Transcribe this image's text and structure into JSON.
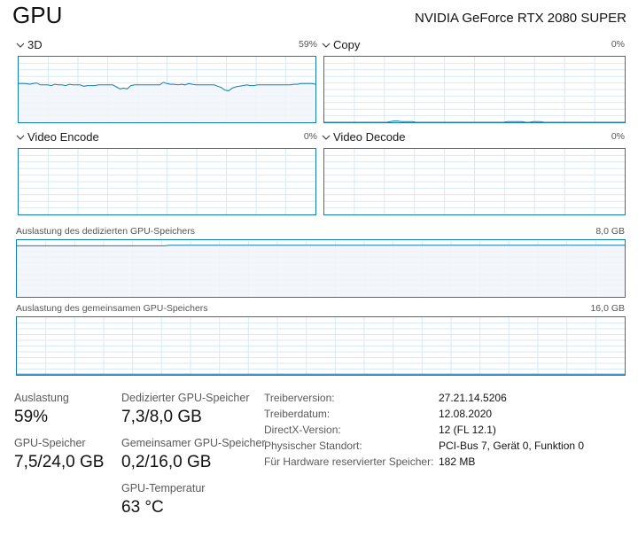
{
  "header": {
    "title": "GPU",
    "device_name": "NVIDIA GeForce RTX 2080 SUPER"
  },
  "engines": [
    {
      "label": "3D",
      "percent": "59%",
      "history_percent": [
        59,
        59,
        59,
        58,
        59,
        60,
        57,
        57,
        57,
        56,
        58,
        57,
        57,
        56,
        58,
        57,
        57,
        57,
        55,
        56,
        56,
        56,
        57,
        57,
        57,
        57,
        57,
        54,
        51,
        52,
        51,
        56,
        57,
        57,
        57,
        57,
        57,
        57,
        57,
        57,
        61,
        59,
        58,
        58,
        57,
        58,
        57,
        59,
        58,
        57,
        57,
        57,
        57,
        57,
        57,
        55,
        53,
        49,
        48,
        52,
        54,
        55,
        56,
        57,
        56,
        56,
        57,
        57,
        57,
        57,
        57,
        57,
        57,
        57,
        57,
        57,
        58,
        58,
        59,
        59,
        59,
        59,
        58
      ]
    },
    {
      "label": "Copy",
      "percent": "0%",
      "history_percent": [
        0,
        0,
        0,
        0,
        0,
        0,
        0,
        0,
        0,
        0,
        0,
        0,
        0,
        0,
        0,
        0,
        0,
        0,
        1,
        2,
        2,
        1,
        1,
        1,
        1,
        0,
        0,
        0,
        0,
        0,
        0,
        0,
        0,
        0,
        0,
        0,
        0,
        0,
        0,
        0,
        0,
        0,
        0,
        0,
        0,
        0,
        0,
        0,
        0,
        0,
        1,
        1,
        1,
        1,
        1,
        0,
        0,
        1,
        1,
        1,
        0,
        0,
        0,
        0,
        0,
        0,
        0,
        0,
        0,
        0,
        0,
        0,
        0,
        0,
        0,
        0,
        0,
        0,
        0,
        0,
        0,
        0,
        0
      ]
    },
    {
      "label": "Video Encode",
      "percent": "0%",
      "history_percent": []
    },
    {
      "label": "Video Decode",
      "percent": "0%",
      "history_percent": []
    }
  ],
  "memory_graphs": [
    {
      "label": "Auslastung des dedizierten GPU-Speichers",
      "max": "8,0 GB",
      "history_percent": [
        90,
        90,
        90,
        90,
        90,
        90,
        90,
        90,
        90,
        90,
        90,
        90,
        90,
        90,
        90,
        90,
        90,
        90,
        90,
        90,
        90,
        90,
        90,
        90,
        90,
        90,
        90,
        90,
        90,
        90,
        90,
        90,
        90,
        90,
        90,
        90,
        90,
        90,
        90,
        90,
        90,
        90,
        91,
        91,
        91,
        91,
        91,
        91,
        91,
        91,
        91,
        91,
        91,
        91,
        91,
        91,
        91,
        91,
        91,
        91,
        91,
        91,
        91,
        91,
        91,
        91,
        91,
        91,
        91,
        91,
        91,
        91,
        91,
        91,
        91,
        91,
        91,
        91,
        91,
        91,
        91,
        91,
        91,
        91,
        91,
        91,
        91,
        91,
        91,
        91,
        91,
        91,
        91,
        91,
        91,
        91,
        91,
        91,
        91,
        91,
        91,
        91,
        91,
        91,
        91,
        91,
        91,
        91,
        91,
        91,
        91,
        91,
        91,
        91,
        91,
        91,
        91,
        91,
        91,
        91,
        91,
        91,
        91,
        91,
        91,
        91,
        91,
        91,
        91,
        91,
        91,
        91,
        91,
        91,
        91,
        91,
        91,
        91,
        91,
        91,
        91,
        91,
        91,
        91,
        91,
        91,
        91,
        91,
        91,
        91,
        91,
        91,
        91,
        91,
        91,
        91,
        91,
        91,
        91,
        91,
        91,
        91,
        91,
        91,
        91,
        91,
        91,
        91,
        91
      ]
    },
    {
      "label": "Auslastung des gemeinsamen GPU-Speichers",
      "max": "16,0 GB",
      "history_percent": [
        1,
        1,
        1,
        1,
        1,
        1,
        1,
        1,
        1,
        1,
        1,
        1,
        1,
        1,
        1,
        1,
        1,
        1,
        1,
        1,
        1,
        1,
        1,
        1,
        1,
        1,
        1,
        1,
        1,
        1,
        1,
        1,
        1,
        1,
        1,
        1,
        1,
        1,
        1,
        1,
        1,
        1,
        1,
        1,
        1,
        1,
        1,
        1,
        1,
        1,
        1,
        1,
        1,
        1,
        1,
        1,
        1,
        1,
        1,
        1,
        1,
        1,
        1,
        1,
        1,
        1,
        1,
        1,
        1,
        1,
        1,
        1,
        1,
        1,
        1,
        1,
        1,
        1,
        1,
        1,
        1,
        1,
        1,
        1,
        1,
        1,
        1,
        1,
        1,
        1,
        1,
        1,
        1,
        1,
        1,
        1,
        1,
        1,
        1,
        1,
        1,
        1,
        1,
        1,
        1,
        1,
        1,
        1,
        1,
        1,
        1,
        1,
        1,
        1,
        1,
        1,
        1,
        1,
        1,
        1,
        1,
        1,
        1,
        1,
        1,
        1,
        1,
        1,
        1,
        1,
        1,
        1,
        1,
        1,
        1,
        1,
        1,
        1,
        1,
        1,
        1,
        1,
        1,
        1,
        1,
        1,
        1,
        1,
        1,
        1,
        1,
        1,
        1,
        1,
        1,
        1,
        1,
        1,
        1,
        1,
        1,
        1,
        1,
        1,
        1,
        1,
        1,
        1,
        1
      ]
    }
  ],
  "stats": {
    "utilization": {
      "label": "Auslastung",
      "value": "59%"
    },
    "gpu_memory": {
      "label": "GPU-Speicher",
      "value": "7,5/24,0 GB"
    },
    "dedicated": {
      "label": "Dedizierter GPU-Speicher",
      "value": "7,3/8,0 GB"
    },
    "shared": {
      "label": "Gemeinsamer GPU-Speicher",
      "value": "0,2/16,0 GB"
    },
    "temperature": {
      "label": "GPU-Temperatur",
      "value": "63 °C"
    }
  },
  "details": [
    {
      "key": "Treiberversion:",
      "value": "27.21.14.5206"
    },
    {
      "key": "Treiberdatum:",
      "value": "12.08.2020"
    },
    {
      "key": "DirectX-Version:",
      "value": "12 (FL 12.1)"
    },
    {
      "key": "Physischer Standort:",
      "value": "PCI-Bus 7, Gerät 0, Funktion 0"
    },
    {
      "key": "Für Hardware reservierter Speicher:",
      "value": "182 MB"
    }
  ],
  "colors": {
    "accent": "#117dbb",
    "grid": "#d9eaf4",
    "fill": "#f1f6fa"
  },
  "icons": {
    "collapse": "chevron-down-icon"
  }
}
